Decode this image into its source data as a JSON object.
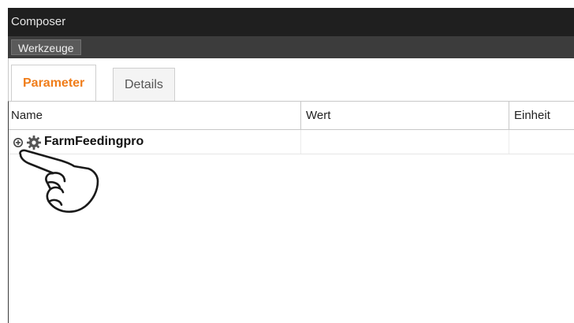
{
  "window": {
    "title": "Composer"
  },
  "menu": {
    "items": [
      {
        "label": "Werkzeuge"
      }
    ]
  },
  "tabs": [
    {
      "label": "Parameter",
      "active": true
    },
    {
      "label": "Details",
      "active": false
    }
  ],
  "table": {
    "columns": [
      {
        "label": "Name"
      },
      {
        "label": "Wert"
      },
      {
        "label": "Einheit"
      }
    ],
    "rows": [
      {
        "icon": "gear-icon",
        "expand_icon": "plus-circle-icon",
        "name": "FarmFeedingpro",
        "value": "",
        "unit": ""
      }
    ]
  },
  "overlay": {
    "icon": "pointing-hand-icon"
  },
  "colors": {
    "active_tab": "#f07d1a",
    "titlebar": "#1f1f1f",
    "menubar": "#3c3c3c"
  }
}
